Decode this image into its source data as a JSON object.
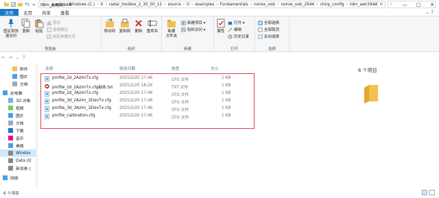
{
  "window": {
    "title": "tdm_awr2944",
    "minimize": "—",
    "maximize": "□",
    "close": "✕"
  },
  "tabs": [
    {
      "label": "文件"
    },
    {
      "label": "主页"
    },
    {
      "label": "共享"
    },
    {
      "label": "查看"
    }
  ],
  "ribbon": {
    "clipboard": {
      "label": "剪贴板",
      "pin": "固定到快速访问",
      "copy": "复制",
      "paste": "粘贴",
      "cut": "剪切",
      "copy_path": "复制路径",
      "paste_shortcut": "粘贴快捷方式"
    },
    "organize": {
      "label": "组织",
      "move_to": "移动到",
      "copy_to": "复制到",
      "delete": "删除",
      "rename": "重命名"
    },
    "new": {
      "label": "新建",
      "new_folder": "新建\n文件夹",
      "new_item": "新建项目 ▾",
      "easy_access": "轻松访问 ▾"
    },
    "open": {
      "label": "打开",
      "properties": "属性",
      "open": "打开 ▾",
      "edit": "编辑",
      "history": "历史记录"
    },
    "select": {
      "label": "选择",
      "select_all": "全部选择",
      "select_none": "全部取消",
      "invert": "反向选择"
    }
  },
  "address": {
    "crumbs": [
      "此电脑",
      "Windows (C:)",
      "ti",
      "radar_toolbox_2_30_00_12",
      "source",
      "ti",
      "examples",
      "Fundamentals",
      "nonos_oob",
      "nonos_oob_2944",
      "chirp_config",
      "tdm_awr2944"
    ]
  },
  "nav": {
    "items": [
      {
        "label": "附件"
      },
      {
        "label": "图片"
      },
      {
        "label": "文档"
      },
      {
        "label": "此电脑"
      },
      {
        "label": "3D 对象"
      },
      {
        "label": "视频"
      },
      {
        "label": "图片"
      },
      {
        "label": "文档"
      },
      {
        "label": "下载"
      },
      {
        "label": "音乐"
      },
      {
        "label": "桌面"
      },
      {
        "label": "Windov"
      },
      {
        "label": "Data (D"
      },
      {
        "label": "新加卷 ("
      },
      {
        "label": "网络"
      }
    ]
  },
  "columns": {
    "name": "名称",
    "date": "修改日期",
    "type": "类型",
    "size": "大小"
  },
  "files": [
    {
      "name": "profile_2d_2AzimTx.cfg",
      "date": "2025/2/20 17:46",
      "type": "CFG 文件",
      "size": "1 KB"
    },
    {
      "name": "profile_2d_2AzimTx.cfg副本.txt",
      "date": "2025/2/25 18:26",
      "type": "TXT 文件",
      "size": "1 KB"
    },
    {
      "name": "profile_2d_3AzimTx.cfg",
      "date": "2025/2/20 17:46",
      "type": "CFG 文件",
      "size": "1 KB"
    },
    {
      "name": "profile_3d_2Azim_1ElevTx.cfg",
      "date": "2025/2/20 17:46",
      "type": "CFG 文件",
      "size": "1 KB"
    },
    {
      "name": "profile_3d_3Azim_1ElevTx.cfg",
      "date": "2025/2/20 17:46",
      "type": "CFG 文件",
      "size": "1 KB"
    },
    {
      "name": "profile_calibration.cfg",
      "date": "2025/2/20 17:46",
      "type": "CFG 文件",
      "size": "1 KB"
    }
  ],
  "preview": {
    "count": "6 个项目"
  },
  "status": {
    "count": "6 个项目"
  },
  "colors": {
    "accent": "#1979ca",
    "folder": "#f2c14e",
    "highlight_box": "#e03b4b",
    "selected_nav": "#cce8ff"
  }
}
